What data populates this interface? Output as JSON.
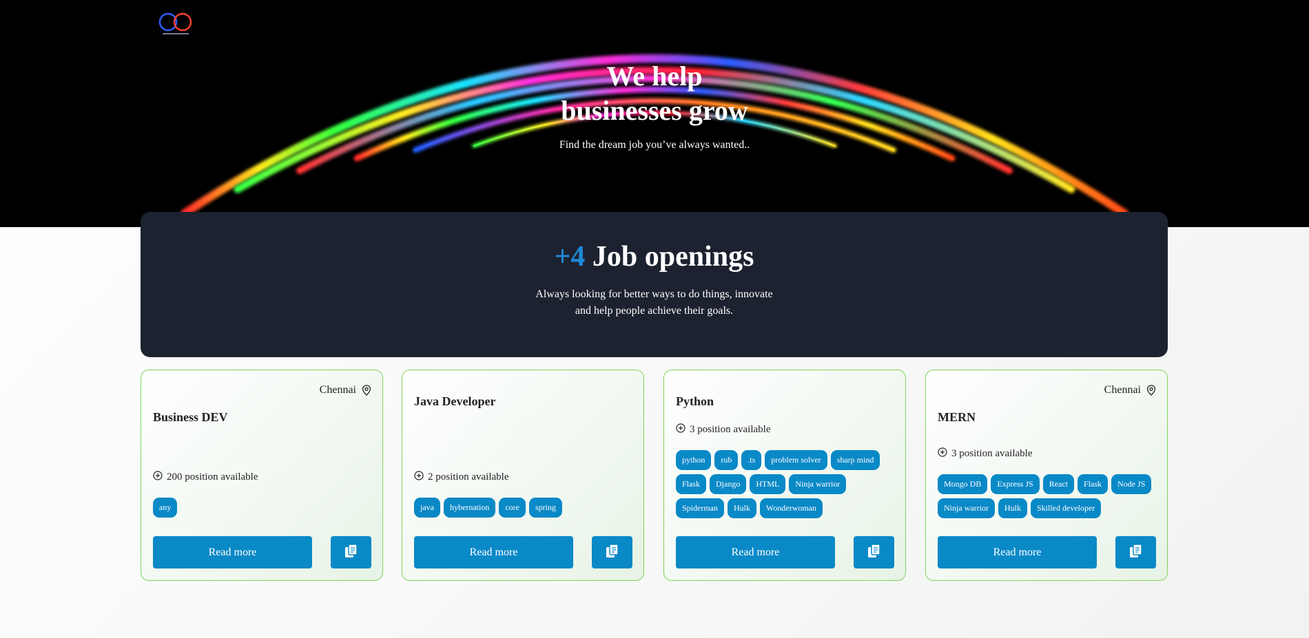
{
  "hero": {
    "title_line1": "We help",
    "title_line2": "businesses grow",
    "subtitle": "Find the dream job you’ve always wanted..",
    "logo_icon": "infinity-logo-icon"
  },
  "openings": {
    "count": "+4",
    "label": "Job openings",
    "desc_line1": "Always looking for better ways to do things, innovate",
    "desc_line2": "and help people achieve their goals."
  },
  "colors": {
    "accent": "#0a89c7",
    "panel_bg": "#1d2230",
    "card_border": "#7fd35b",
    "count_blue": "#1e88d6"
  },
  "jobs": [
    {
      "location": "Chennai",
      "title": "Business DEV",
      "positions": "200 position available",
      "tags": [
        "any"
      ],
      "read_more": "Read more"
    },
    {
      "location": "",
      "title": "Java Developer",
      "positions": "2 position available",
      "tags": [
        "java",
        "hybernation",
        "core",
        "spring"
      ],
      "read_more": "Read more"
    },
    {
      "location": "",
      "title": "Python",
      "positions": "3 position available",
      "tags": [
        "python",
        "rub",
        ".ts",
        "problem solver",
        "sharp mind",
        "Flask",
        "Django",
        "HTML",
        "Ninja warrior",
        "Spiderman",
        "Hulk",
        "Wonderwoman"
      ],
      "read_more": "Read more"
    },
    {
      "location": "Chennai",
      "title": "MERN",
      "positions": "3 position available",
      "tags": [
        "Mongo DB",
        "Express JS",
        "React",
        "Flask",
        "Node JS",
        "Ninja warrior",
        "Hulk",
        "Skilled developer"
      ],
      "read_more": "Read more"
    }
  ]
}
